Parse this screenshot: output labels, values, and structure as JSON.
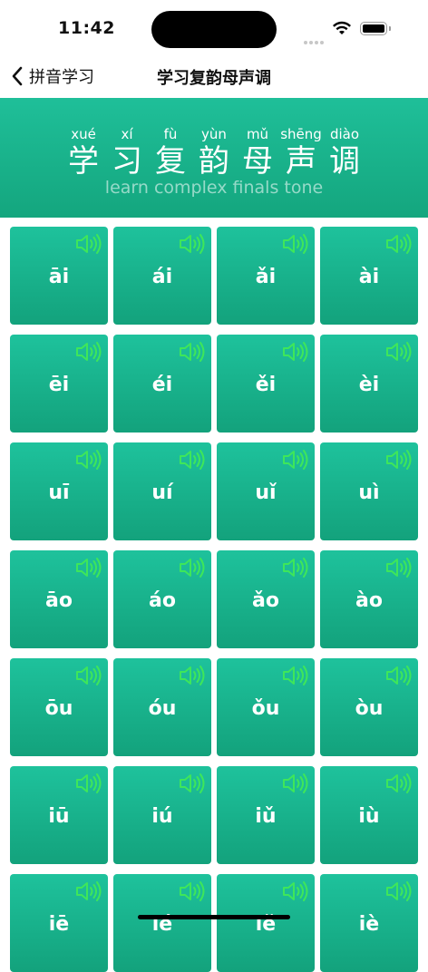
{
  "status_bar": {
    "time": "11:42"
  },
  "nav": {
    "back_label": "拼音学习",
    "title": "学习复韵母声调"
  },
  "banner": {
    "characters": [
      {
        "pinyin": "xué",
        "hanzi": "学"
      },
      {
        "pinyin": "xí",
        "hanzi": "习"
      },
      {
        "pinyin": "fù",
        "hanzi": "复"
      },
      {
        "pinyin": "yùn",
        "hanzi": "韵"
      },
      {
        "pinyin": "mǔ",
        "hanzi": "母"
      },
      {
        "pinyin": "shēng",
        "hanzi": "声"
      },
      {
        "pinyin": "diào",
        "hanzi": "调"
      }
    ],
    "subtitle": "learn complex finals tone"
  },
  "cards": [
    {
      "label": "āi"
    },
    {
      "label": "ái"
    },
    {
      "label": "ǎi"
    },
    {
      "label": "ài"
    },
    {
      "label": "ēi"
    },
    {
      "label": "éi"
    },
    {
      "label": "ěi"
    },
    {
      "label": "èi"
    },
    {
      "label": "uī"
    },
    {
      "label": "uí"
    },
    {
      "label": "uǐ"
    },
    {
      "label": "uì"
    },
    {
      "label": "āo"
    },
    {
      "label": "áo"
    },
    {
      "label": "ǎo"
    },
    {
      "label": "ào"
    },
    {
      "label": "ōu"
    },
    {
      "label": "óu"
    },
    {
      "label": "ǒu"
    },
    {
      "label": "òu"
    },
    {
      "label": "iū"
    },
    {
      "label": "iú"
    },
    {
      "label": "iǔ"
    },
    {
      "label": "iù"
    },
    {
      "label": "iē"
    },
    {
      "label": "ié"
    },
    {
      "label": "iě"
    },
    {
      "label": "iè"
    }
  ],
  "icons": {
    "card_icon": "speaker-icon",
    "back_icon": "chevron-left-icon"
  },
  "colors": {
    "accent": "#1ab592",
    "speaker": "#3ee65a",
    "text_on_accent": "#ffffff"
  }
}
